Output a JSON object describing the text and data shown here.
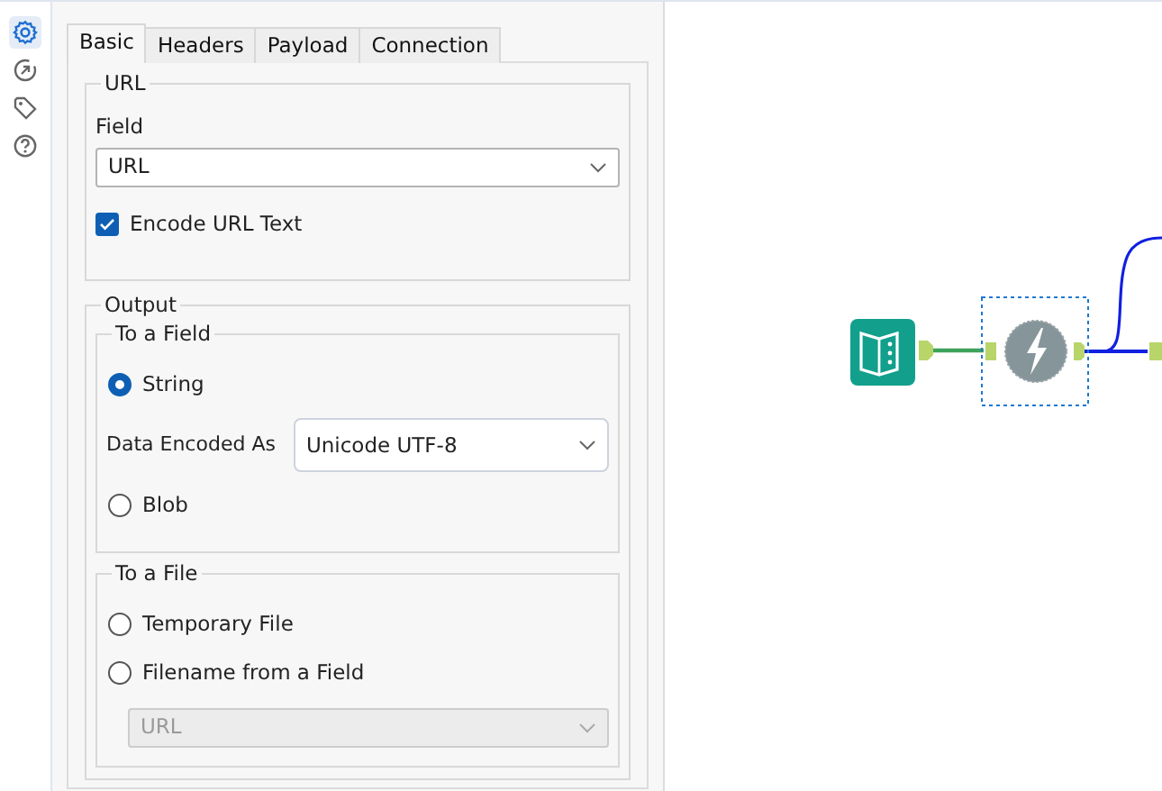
{
  "sidebar": [
    {
      "kind": "settings",
      "selected": true
    },
    {
      "kind": "annotation",
      "selected": false
    },
    {
      "kind": "tag",
      "selected": false
    },
    {
      "kind": "help",
      "selected": false
    }
  ],
  "tabs": [
    {
      "label": "Basic",
      "selected": true
    },
    {
      "label": "Headers",
      "selected": false
    },
    {
      "label": "Payload",
      "selected": false
    },
    {
      "label": "Connection",
      "selected": false
    }
  ],
  "url_group": {
    "legend": "URL",
    "field_label": "Field",
    "field": {
      "value": "URL"
    },
    "encode": {
      "label": "Encode URL Text",
      "checked": true
    }
  },
  "output_group": {
    "legend": "Output",
    "to_field": {
      "legend": "To a Field",
      "options": [
        {
          "label": "String",
          "selected": true
        },
        {
          "label": "Blob",
          "selected": false
        }
      ],
      "encoding_label": "Data Encoded As",
      "encoding": {
        "value": "Unicode UTF-8"
      }
    },
    "to_file": {
      "legend": "To a File",
      "options": [
        {
          "label": "Temporary File",
          "selected": false
        },
        {
          "label": "Filename from a Field",
          "selected": false
        }
      ],
      "filename_field": {
        "value": "URL",
        "disabled": true
      }
    }
  },
  "canvas": {
    "tools": [
      {
        "kind": "input",
        "selected": false
      },
      {
        "kind": "download",
        "selected": true
      }
    ]
  }
}
